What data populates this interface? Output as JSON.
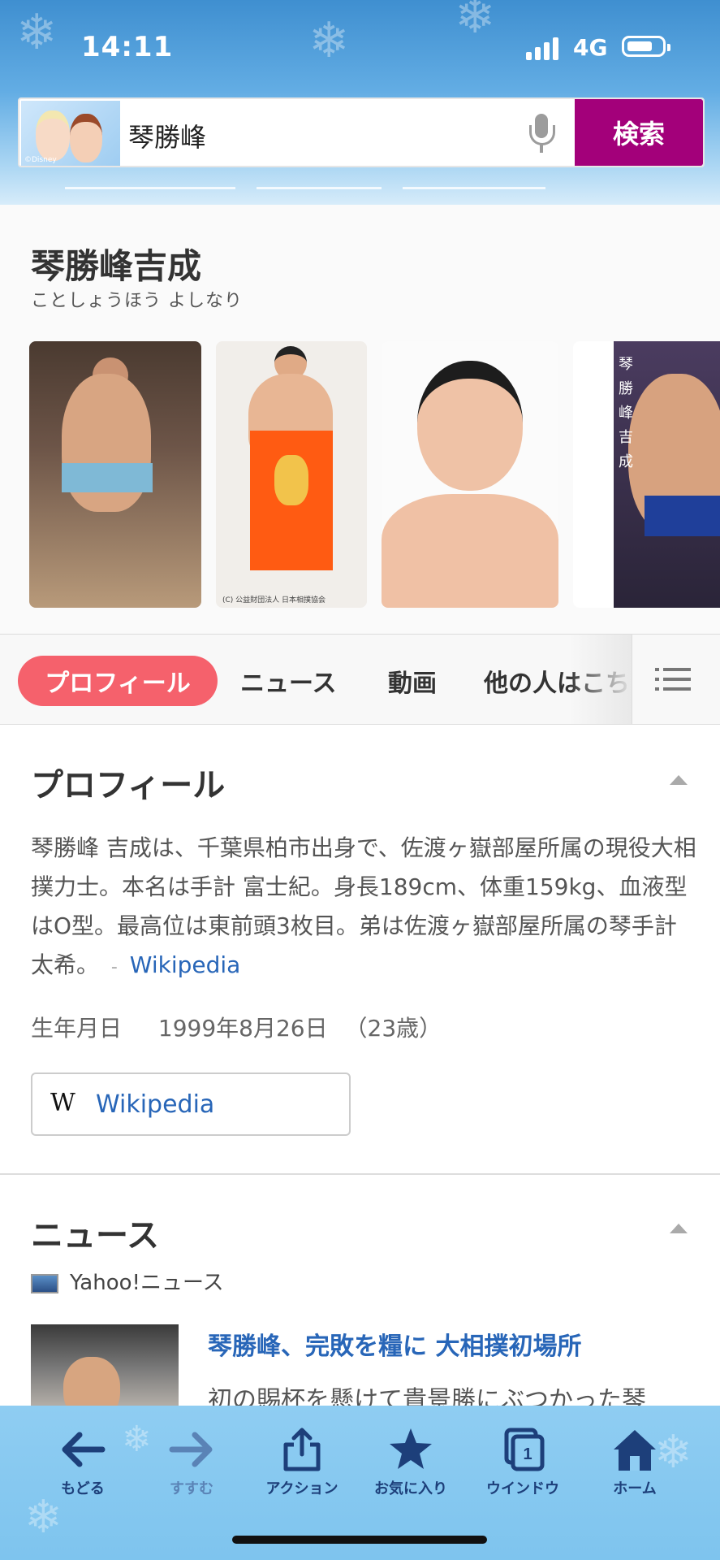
{
  "status_bar": {
    "time": "14:11",
    "network": "4G"
  },
  "search": {
    "query": "琴勝峰",
    "button_label": "検索",
    "avatar_caption": "©Disney"
  },
  "knowledge_panel": {
    "name": "琴勝峰吉成",
    "reading": "ことしょうほう よしなり",
    "photo_captions": {
      "p2": "(C) 公益財団法人 日本相撲協会",
      "p4": "琴勝峰吉成"
    }
  },
  "tabs": {
    "items": [
      "プロフィール",
      "ニュース",
      "動画",
      "他の人はこち"
    ],
    "active_index": 0
  },
  "profile": {
    "title": "プロフィール",
    "description": "琴勝峰 吉成は、千葉県柏市出身で、佐渡ヶ嶽部屋所属の現役大相撲力士。本名は手計 富士紀。身長189cm、体重159kg、血液型はO型。最高位は東前頭3枚目。弟は佐渡ヶ嶽部屋所属の琴手計太希。",
    "source_dash": "-",
    "source": "Wikipedia",
    "birth_label": "生年月日",
    "birth_date": "1999年8月26日",
    "age": "（23歳）",
    "wiki_button": {
      "icon": "W",
      "label": "Wikipedia"
    }
  },
  "news": {
    "title": "ニュース",
    "provider": "Yahoo!ニュース",
    "items": [
      {
        "title": "琴勝峰、完敗を糧に 大相撲初場所",
        "snippet": "初の賜杯を懸けて貴景勝にぶつかった琴"
      }
    ]
  },
  "toolbar": {
    "items": [
      {
        "label": "もどる",
        "icon": "back-arrow-icon",
        "enabled": true
      },
      {
        "label": "すすむ",
        "icon": "forward-arrow-icon",
        "enabled": false
      },
      {
        "label": "アクション",
        "icon": "share-icon",
        "enabled": true
      },
      {
        "label": "お気に入り",
        "icon": "star-icon",
        "enabled": true
      },
      {
        "label": "ウインドウ",
        "icon": "window-icon",
        "enabled": true,
        "badge": "1"
      },
      {
        "label": "ホーム",
        "icon": "home-icon",
        "enabled": true
      }
    ]
  },
  "colors": {
    "search_button": "#a3007a",
    "active_tab": "#f5616c",
    "link": "#2866b8",
    "toolbar_icon": "#1d3f7a"
  }
}
